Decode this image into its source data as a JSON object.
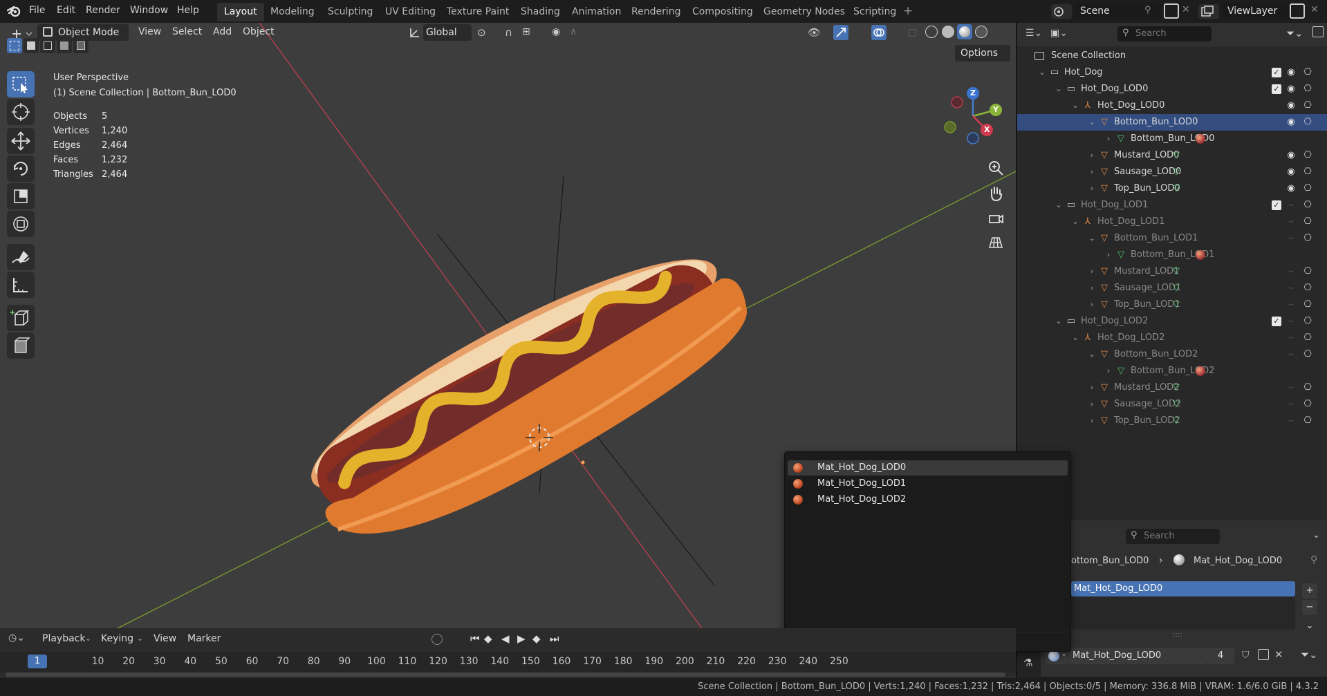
{
  "topbar": {
    "menus": [
      "File",
      "Edit",
      "Render",
      "Window",
      "Help"
    ],
    "workspaces": [
      "Layout",
      "Modeling",
      "Sculpting",
      "UV Editing",
      "Texture Paint",
      "Shading",
      "Animation",
      "Rendering",
      "Compositing",
      "Geometry Nodes",
      "Scripting"
    ],
    "active_workspace": "Layout",
    "add_tab_icon": "+",
    "scene_name": "Scene",
    "viewlayer_name": "ViewLayer"
  },
  "viewport_header": {
    "mode": "Object Mode",
    "menus": [
      "View",
      "Select",
      "Add",
      "Object"
    ],
    "transform_orientation": "Global",
    "options_label": "Options"
  },
  "viewport_info": {
    "perspective": "User Perspective",
    "context": "(1) Scene Collection | Bottom_Bun_LOD0",
    "stats": [
      {
        "label": "Objects",
        "value": "5"
      },
      {
        "label": "Vertices",
        "value": "1,240"
      },
      {
        "label": "Edges",
        "value": "2,464"
      },
      {
        "label": "Faces",
        "value": "1,232"
      },
      {
        "label": "Triangles",
        "value": "2,464"
      }
    ]
  },
  "gizmo": {
    "x": "X",
    "y": "Y",
    "z": "Z"
  },
  "outliner": {
    "search_placeholder": "Search",
    "root": "Scene Collection",
    "rows": [
      {
        "label": "Hot_Dog",
        "type": "collection",
        "depth": 0,
        "check": true,
        "eye": true,
        "cam": true
      },
      {
        "label": "Hot_Dog_LOD0",
        "type": "collection",
        "depth": 1,
        "check": true,
        "eye": true,
        "cam": true
      },
      {
        "label": "Hot_Dog_LOD0",
        "type": "empty",
        "depth": 2,
        "eye": true,
        "cam": true
      },
      {
        "label": "Bottom_Bun_LOD0",
        "type": "mesh",
        "depth": 3,
        "selected": true,
        "eye": true,
        "cam": true
      },
      {
        "label": "Bottom_Bun_LOD0",
        "type": "meshdata",
        "depth": 4,
        "mat": true
      },
      {
        "label": "Mustard_LOD0",
        "type": "mesh",
        "depth": 3,
        "green": true,
        "eye": true,
        "cam": true
      },
      {
        "label": "Sausage_LOD0",
        "type": "mesh",
        "depth": 3,
        "green": true,
        "eye": true,
        "cam": true
      },
      {
        "label": "Top_Bun_LOD0",
        "type": "mesh",
        "depth": 3,
        "green": true,
        "eye": true,
        "cam": true
      },
      {
        "label": "Hot_Dog_LOD1",
        "type": "collection",
        "depth": 1,
        "check": true,
        "cam": true,
        "dim": true
      },
      {
        "label": "Hot_Dog_LOD1",
        "type": "empty",
        "depth": 2,
        "cam": true,
        "dim": true
      },
      {
        "label": "Bottom_Bun_LOD1",
        "type": "mesh",
        "depth": 3,
        "cam": true,
        "dim": true
      },
      {
        "label": "Bottom_Bun_LOD1",
        "type": "meshdata",
        "depth": 4,
        "mat": true,
        "dim": true
      },
      {
        "label": "Mustard_LOD1",
        "type": "mesh",
        "depth": 3,
        "green": true,
        "cam": true,
        "dim": true
      },
      {
        "label": "Sausage_LOD1",
        "type": "mesh",
        "depth": 3,
        "green": true,
        "cam": true,
        "dim": true
      },
      {
        "label": "Top_Bun_LOD1",
        "type": "mesh",
        "depth": 3,
        "green": true,
        "cam": true,
        "dim": true
      },
      {
        "label": "Hot_Dog_LOD2",
        "type": "collection",
        "depth": 1,
        "check": true,
        "cam": true,
        "dim": true
      },
      {
        "label": "Hot_Dog_LOD2",
        "type": "empty",
        "depth": 2,
        "cam": true,
        "dim": true
      },
      {
        "label": "Bottom_Bun_LOD2",
        "type": "mesh",
        "depth": 3,
        "cam": true,
        "dim": true
      },
      {
        "label": "Bottom_Bun_LOD2",
        "type": "meshdata",
        "depth": 4,
        "mat": true,
        "dim": true
      },
      {
        "label": "Mustard_LOD2",
        "type": "mesh",
        "depth": 3,
        "green": true,
        "cam": true,
        "dim": true
      },
      {
        "label": "Sausage_LOD2",
        "type": "mesh",
        "depth": 3,
        "green": true,
        "cam": true,
        "dim": true
      },
      {
        "label": "Top_Bun_LOD2",
        "type": "mesh",
        "depth": 3,
        "green": true,
        "cam": true,
        "dim": true
      }
    ]
  },
  "material_dropdown": {
    "items": [
      "Mat_Hot_Dog_LOD0",
      "Mat_Hot_Dog_LOD1",
      "Mat_Hot_Dog_LOD2"
    ],
    "highlighted": 0,
    "search_value": ""
  },
  "properties": {
    "search_placeholder": "Search",
    "breadcrumb_object": "ottom_Bun_LOD0",
    "breadcrumb_material": "Mat_Hot_Dog_LOD0",
    "slot_name": "Mat_Hot_Dog_LOD0",
    "material_field": "Mat_Hot_Dog_LOD0",
    "user_count": "4",
    "add_icon": "+",
    "remove_icon": "−",
    "more_icon": "⌄",
    "grip": "::::"
  },
  "timeline": {
    "menus": [
      "Playback",
      "Keying",
      "View",
      "Marker"
    ],
    "current_frame": "1",
    "ticks": [
      "10",
      "20",
      "30",
      "40",
      "50",
      "60",
      "70",
      "80",
      "90",
      "100",
      "110",
      "120",
      "130",
      "140",
      "150",
      "160",
      "170",
      "180",
      "190",
      "200",
      "210",
      "220",
      "230",
      "240",
      "250"
    ]
  },
  "statusbar": {
    "text": "Scene Collection | Bottom_Bun_LOD0 | Verts:1,240 | Faces:1,232 | Tris:2,464 | Objects:0/5 | Memory: 336.8 MiB | VRAM: 1.6/6.0 GiB | 4.3.2"
  },
  "colors": {
    "accent": "#4772b3",
    "selected_row": "#334d80",
    "axis_red": "#b34050",
    "axis_green": "#7a9a30",
    "mesh_orange": "#e08a4a",
    "mesh_green": "#4fbf6a"
  }
}
